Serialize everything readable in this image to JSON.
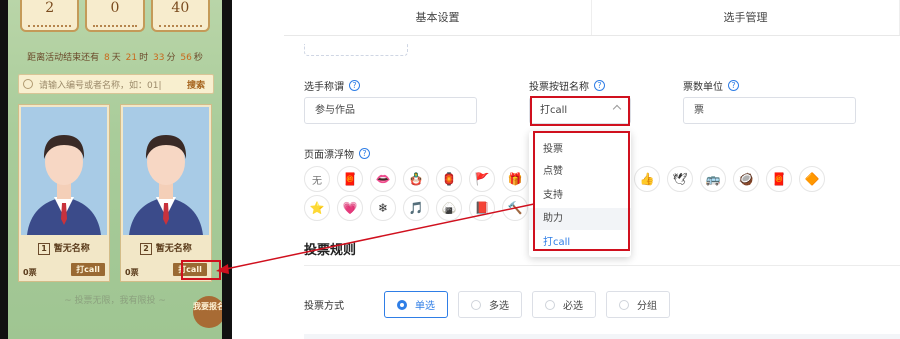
{
  "phone": {
    "counters": [
      "2",
      "0",
      "40"
    ],
    "countdown": {
      "prefix": "距离活动结束还有",
      "days": "8",
      "days_unit": "天",
      "hours": "21",
      "hours_unit": "时",
      "minutes": "33",
      "minutes_unit": "分",
      "seconds": "56",
      "seconds_unit": "秒"
    },
    "search": {
      "placeholder": "请输入编号或者名称，如：01|",
      "button": "搜索"
    },
    "cards": [
      {
        "number": "1",
        "name": "暂无名称",
        "votes": "0票",
        "vote_button": "打call"
      },
      {
        "number": "2",
        "name": "暂无名称",
        "votes": "0票",
        "vote_button": "打call"
      }
    ],
    "rule_text": "~ 投票无限，我有限投 ~",
    "signup_button": "我要报名"
  },
  "panel": {
    "tabs": [
      "基本设置",
      "选手管理"
    ],
    "fields": {
      "player_title": {
        "label": "选手称谓",
        "value": "参与作品"
      },
      "vote_button_name": {
        "label": "投票按钮名称",
        "value": "打call"
      },
      "vote_unit": {
        "label": "票数单位",
        "value": "票"
      }
    },
    "floats": {
      "label": "页面漂浮物",
      "none_label": "无",
      "row1": [
        "🧧",
        "👄",
        "🪆",
        "🏮",
        "🚩",
        "🎁",
        "",
        "",
        "🍡",
        "👍",
        "🕊",
        "🚌",
        "🥥",
        "🧧",
        "🔶"
      ],
      "row2": [
        "⭐",
        "💗",
        "❄",
        "🎵",
        "🍙",
        "📕",
        "🔨"
      ]
    },
    "dropdown_options": [
      "投票",
      "点赞",
      "支持",
      "助力",
      "打call"
    ],
    "dropdown_selected": "打call",
    "dropdown_hover": "助力",
    "section_title": "投票规则",
    "vote_mode": {
      "label": "投票方式",
      "options": [
        "单选",
        "多选",
        "必选",
        "分组"
      ],
      "selected": "单选"
    }
  },
  "colors": {
    "accent_blue": "#2f7ee6",
    "highlight_red": "#d0101e",
    "phone_bg_green": "#a9cc9a",
    "vote_button_brown": "#9a6a33"
  }
}
